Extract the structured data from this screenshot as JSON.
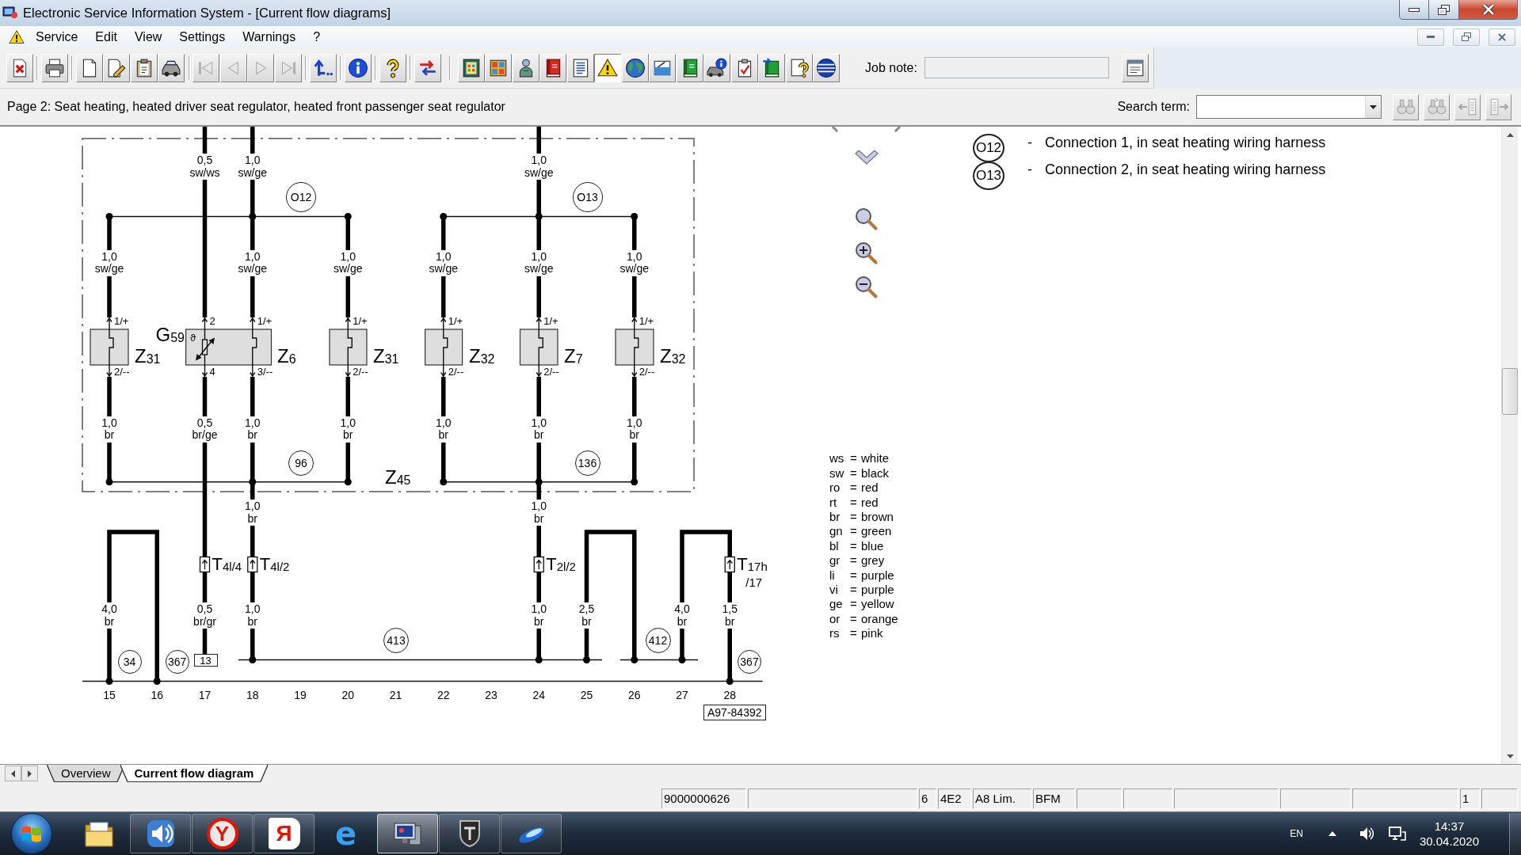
{
  "window": {
    "title": "Electronic Service Information System - [Current flow diagrams]"
  },
  "menu": [
    "Service",
    "Edit",
    "View",
    "Settings",
    "Warnings",
    "?"
  ],
  "toolbar": {
    "groups": [
      [
        {
          "kind": "exit",
          "disabled": false,
          "pressed": false
        }
      ],
      [
        {
          "kind": "print",
          "disabled": false,
          "pressed": false
        }
      ],
      [
        {
          "kind": "new",
          "disabled": false,
          "pressed": false
        },
        {
          "kind": "edit",
          "disabled": false,
          "pressed": false
        },
        {
          "kind": "clipboard",
          "disabled": false,
          "pressed": false
        },
        {
          "kind": "vehicle",
          "disabled": false,
          "pressed": false
        }
      ],
      [
        {
          "kind": "first",
          "disabled": true,
          "pressed": false
        },
        {
          "kind": "prev",
          "disabled": true,
          "pressed": false
        },
        {
          "kind": "next",
          "disabled": true,
          "pressed": false
        },
        {
          "kind": "last",
          "disabled": true,
          "pressed": false
        }
      ],
      [
        {
          "kind": "up",
          "disabled": false,
          "pressed": false
        }
      ],
      [
        {
          "kind": "info",
          "disabled": false,
          "pressed": false
        }
      ],
      [
        {
          "kind": "help",
          "disabled": false,
          "pressed": false
        }
      ],
      [
        {
          "kind": "swap",
          "disabled": false,
          "pressed": false
        }
      ],
      [
        {
          "kind": "framed",
          "disabled": false,
          "pressed": false
        },
        {
          "kind": "grid",
          "disabled": false,
          "pressed": false
        },
        {
          "kind": "figure",
          "disabled": false,
          "pressed": false
        },
        {
          "kind": "bookred",
          "disabled": false,
          "pressed": false
        },
        {
          "kind": "list",
          "disabled": false,
          "pressed": false
        },
        {
          "kind": "warning",
          "disabled": false,
          "pressed": true
        },
        {
          "kind": "globe",
          "disabled": false,
          "pressed": false
        },
        {
          "kind": "window",
          "disabled": false,
          "pressed": false
        },
        {
          "kind": "bookgreen",
          "disabled": false,
          "pressed": false
        },
        {
          "kind": "carinfo",
          "disabled": false,
          "pressed": false
        },
        {
          "kind": "checklist",
          "disabled": false,
          "pressed": false
        },
        {
          "kind": "bookarrow",
          "disabled": false,
          "pressed": false
        },
        {
          "kind": "helpdoc",
          "disabled": false,
          "pressed": false
        },
        {
          "kind": "sphere",
          "disabled": false,
          "pressed": false
        }
      ]
    ],
    "job_note": {
      "label": "Job note:"
    }
  },
  "page_bar": {
    "title": "Page 2: Seat heating, heated driver seat regulator, heated front passenger seat regulator",
    "search": {
      "label": "Search term:"
    },
    "buttons": [
      {
        "kind": "find",
        "disabled": true
      },
      {
        "kind": "findnext",
        "disabled": true
      },
      {
        "kind": "listprev",
        "disabled": true
      },
      {
        "kind": "listnext",
        "disabled": true
      }
    ]
  },
  "diagram": {
    "wire_labels": [
      {
        "size": "0,5",
        "code": "sw/ws"
      },
      {
        "size": "1,0",
        "code": "sw/ge"
      },
      {
        "size": "1,0",
        "code": "sw/ge"
      },
      {
        "size": "1,0",
        "code": "sw/ge"
      },
      {
        "size": "1,0",
        "code": "sw/ge"
      },
      {
        "size": "1,0",
        "code": "sw/ge"
      },
      {
        "size": "1,0",
        "code": "sw/ge"
      },
      {
        "size": "1,0",
        "code": "sw/ge"
      },
      {
        "size": "1,0",
        "code": "sw/ge"
      },
      {
        "size": "1,0",
        "code": "br"
      },
      {
        "size": "0,5",
        "code": "br/ge"
      },
      {
        "size": "1,0",
        "code": "br"
      },
      {
        "size": "1,0",
        "code": "br"
      },
      {
        "size": "1,0",
        "code": "br"
      },
      {
        "size": "1,0",
        "code": "br"
      },
      {
        "size": "1,0",
        "code": "br"
      },
      {
        "size": "1,0",
        "code": "br"
      },
      {
        "size": "1,0",
        "code": "br"
      },
      {
        "size": "4,0",
        "code": "br"
      },
      {
        "size": "0,5",
        "code": "br/gr"
      },
      {
        "size": "1,0",
        "code": "br"
      },
      {
        "size": "1,0",
        "code": "br"
      },
      {
        "size": "2,5",
        "code": "br"
      },
      {
        "size": "4,0",
        "code": "br"
      },
      {
        "size": "1,5",
        "code": "br"
      }
    ],
    "components": [
      {
        "label": "Z$_{31}$"
      },
      {
        "label": "G$_{59}$",
        "symbol": "ϑ"
      },
      {
        "label": "Z$_{6}$"
      },
      {
        "label": "Z$_{31}$"
      },
      {
        "label": "Z$_{32}$"
      },
      {
        "label": "Z$_{7}$"
      },
      {
        "label": "Z$_{32}$"
      },
      {
        "label": "Z$_{45}$"
      }
    ],
    "pins": [
      "1/+",
      "2/--",
      "2",
      "4",
      "1/+",
      "3/--",
      "1/+",
      "2/--",
      "1/+",
      "2/--",
      "1/+",
      "2/--",
      "1/+",
      "2/--"
    ],
    "connectors": [
      {
        "label": "T$_{4l/4}$"
      },
      {
        "label": "T$_{4l/2}$"
      },
      {
        "label": "T$_{2l/2}$"
      },
      {
        "label": "T$_{17h}$",
        "suffix": "/17"
      }
    ],
    "markers": [
      {
        "kind": "circle",
        "text": "O12"
      },
      {
        "kind": "circle",
        "text": "O13"
      },
      {
        "kind": "circle",
        "text": "96"
      },
      {
        "kind": "circle",
        "text": "136"
      },
      {
        "kind": "circle",
        "text": "413"
      },
      {
        "kind": "circle",
        "text": "412"
      },
      {
        "kind": "circle",
        "text": "34"
      },
      {
        "kind": "circle",
        "text": "367"
      },
      {
        "kind": "box",
        "text": "13"
      },
      {
        "kind": "circle",
        "text": "367"
      }
    ],
    "columns": [
      "15",
      "16",
      "17",
      "18",
      "19",
      "20",
      "21",
      "22",
      "23",
      "24",
      "25",
      "26",
      "27",
      "28"
    ],
    "reference": "A97-84392"
  },
  "legend": {
    "connections": [
      {
        "marker": "O12",
        "dash": "-",
        "text": "Connection 1, in seat heating wiring harness"
      },
      {
        "marker": "O13",
        "dash": "-",
        "text": "Connection 2, in seat heating wiring harness"
      }
    ],
    "color_key": [
      {
        "code": "ws",
        "sign": "=",
        "name": "white"
      },
      {
        "code": "sw",
        "sign": "=",
        "name": "black"
      },
      {
        "code": "ro",
        "sign": "=",
        "name": "red"
      },
      {
        "code": "rt",
        "sign": "=",
        "name": "red"
      },
      {
        "code": "br",
        "sign": "=",
        "name": "brown"
      },
      {
        "code": "gn",
        "sign": "=",
        "name": "green"
      },
      {
        "code": "bl",
        "sign": "=",
        "name": "blue"
      },
      {
        "code": "gr",
        "sign": "=",
        "name": "grey"
      },
      {
        "code": "li",
        "sign": "=",
        "name": "purple"
      },
      {
        "code": "vi",
        "sign": "=",
        "name": "purple"
      },
      {
        "code": "ge",
        "sign": "=",
        "name": "yellow"
      },
      {
        "code": "or",
        "sign": "=",
        "name": "orange"
      },
      {
        "code": "rs",
        "sign": "=",
        "name": "pink"
      }
    ]
  },
  "tabs": [
    {
      "label": "Overview",
      "selected": false
    },
    {
      "label": "Current flow diagram",
      "selected": true
    }
  ],
  "status_bar": [
    "9000000626",
    "6",
    "4E2",
    "A8 Lim.",
    "BFM",
    "1"
  ],
  "taskbar": {
    "apps": [
      {
        "kind": "folder",
        "running": false,
        "active": false
      },
      {
        "kind": "speaker",
        "running": true,
        "active": false
      },
      {
        "kind": "roundletter",
        "glyph": "Y",
        "running": true,
        "active": false
      },
      {
        "kind": "tagletter",
        "glyph": "Я",
        "running": true,
        "active": false
      },
      {
        "kind": "orbitletter",
        "glyph": "e",
        "running": false,
        "active": false
      },
      {
        "kind": "computer",
        "running": true,
        "active": true
      },
      {
        "kind": "shield",
        "running": true,
        "active": false
      },
      {
        "kind": "swoosh",
        "running": true,
        "active": false
      }
    ],
    "tray": {
      "language": "EN",
      "time": "14:37",
      "date": "30.04.2020"
    }
  }
}
